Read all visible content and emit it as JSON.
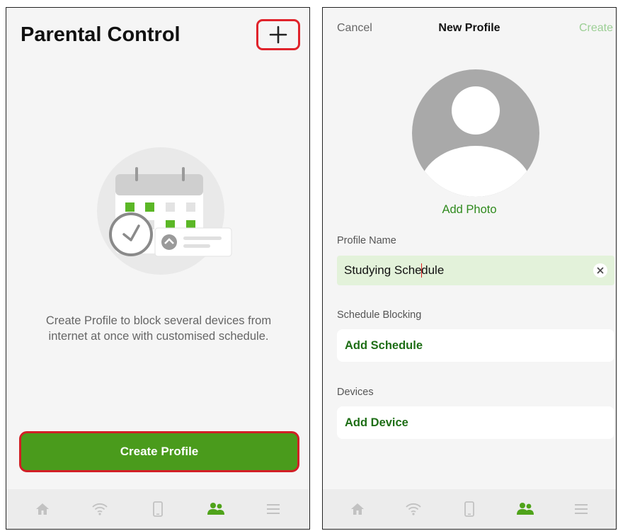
{
  "left_screen": {
    "title": "Parental Control",
    "add_button_symbol": "+",
    "empty_message": "Create Profile to block several devices from internet at once with customised schedule.",
    "create_profile_label": "Create Profile"
  },
  "right_screen": {
    "cancel_label": "Cancel",
    "title": "New Profile",
    "create_label": "Create",
    "add_photo_label": "Add Photo",
    "profile_name_label": "Profile Name",
    "profile_name_value_before_cursor": "Studying Sche",
    "profile_name_value_after_cursor": "dule",
    "schedule_section_label": "Schedule Blocking",
    "add_schedule_label": "Add Schedule",
    "devices_section_label": "Devices",
    "add_device_label": "Add Device"
  },
  "bottom_nav": [
    {
      "icon": "home-icon",
      "active": false
    },
    {
      "icon": "wifi-icon",
      "active": false
    },
    {
      "icon": "phone-icon",
      "active": false
    },
    {
      "icon": "people-icon",
      "active": true
    },
    {
      "icon": "menu-icon",
      "active": false
    }
  ],
  "colors": {
    "accent_green": "#4a9b1c",
    "highlight_red": "#e0232b",
    "disabled_green": "#9ccf95",
    "field_bg": "#e3f2da"
  }
}
